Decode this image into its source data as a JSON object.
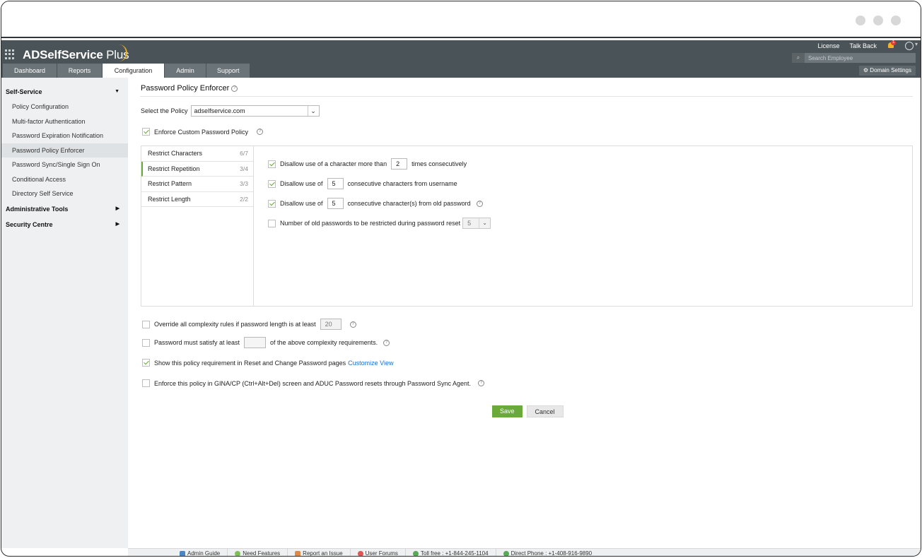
{
  "app": {
    "name": "ADSelfService",
    "name_suffix": "Plus",
    "top_links": [
      "License",
      "Talk Back"
    ],
    "notification_count": "1",
    "search_placeholder": "Search Employee",
    "domain_settings_label": "Domain Settings"
  },
  "tabs": [
    {
      "label": "Dashboard"
    },
    {
      "label": "Reports"
    },
    {
      "label": "Configuration",
      "active": true
    },
    {
      "label": "Admin"
    },
    {
      "label": "Support"
    }
  ],
  "sidebar": {
    "self_service": {
      "title": "Self-Service",
      "items": [
        "Policy Configuration",
        "Multi-factor Authentication",
        "Password Expiration Notification",
        "Password Policy Enforcer",
        "Password Sync/Single Sign On",
        "Conditional Access",
        "Directory Self Service"
      ]
    },
    "admin_tools": "Administrative Tools",
    "security_centre": "Security Centre"
  },
  "page": {
    "title": "Password Policy Enforcer",
    "select_policy_label": "Select the Policy",
    "selected_policy": "adselfservice.com",
    "enforce_label": "Enforce Custom Password Policy",
    "vtabs": [
      {
        "label": "Restrict Characters",
        "count": "6/7"
      },
      {
        "label": "Restrict Repetition",
        "count": "3/4"
      },
      {
        "label": "Restrict Pattern",
        "count": "3/3"
      },
      {
        "label": "Restrict Length",
        "count": "2/2"
      }
    ],
    "rules": {
      "r1_pre": "Disallow use of a character more than",
      "r1_val": "2",
      "r1_post": "times consecutively",
      "r2_pre": "Disallow use of",
      "r2_val": "5",
      "r2_post": "consecutive characters from username",
      "r3_pre": "Disallow use of",
      "r3_val": "5",
      "r3_post": "consecutive character(s) from old password",
      "r4_label": "Number of old passwords to be restricted during password reset",
      "r4_val": "5"
    },
    "override_label": "Override all complexity rules if password length is at least",
    "override_val": "20",
    "satisfy_pre": "Password must satisfy at least",
    "satisfy_val": "",
    "satisfy_post": "of the above complexity requirements.",
    "show_policy_label": "Show this policy requirement in Reset and Change Password pages",
    "customize_view": "Customize View",
    "gina_label": "Enforce this policy in GINA/CP (Ctrl+Alt+Del) screen and ADUC Password resets through Password Sync Agent.",
    "save": "Save",
    "cancel": "Cancel"
  },
  "footer": [
    "Admin Guide",
    "Need Features",
    "Report an Issue",
    "User Forums",
    "Toll free : +1-844-245-1104",
    "Direct Phone : +1-408-916-9890"
  ],
  "colors": {
    "header_bg": "#4a5357",
    "accent_green": "#6aaa3a",
    "link_blue": "#1a6ecf"
  }
}
